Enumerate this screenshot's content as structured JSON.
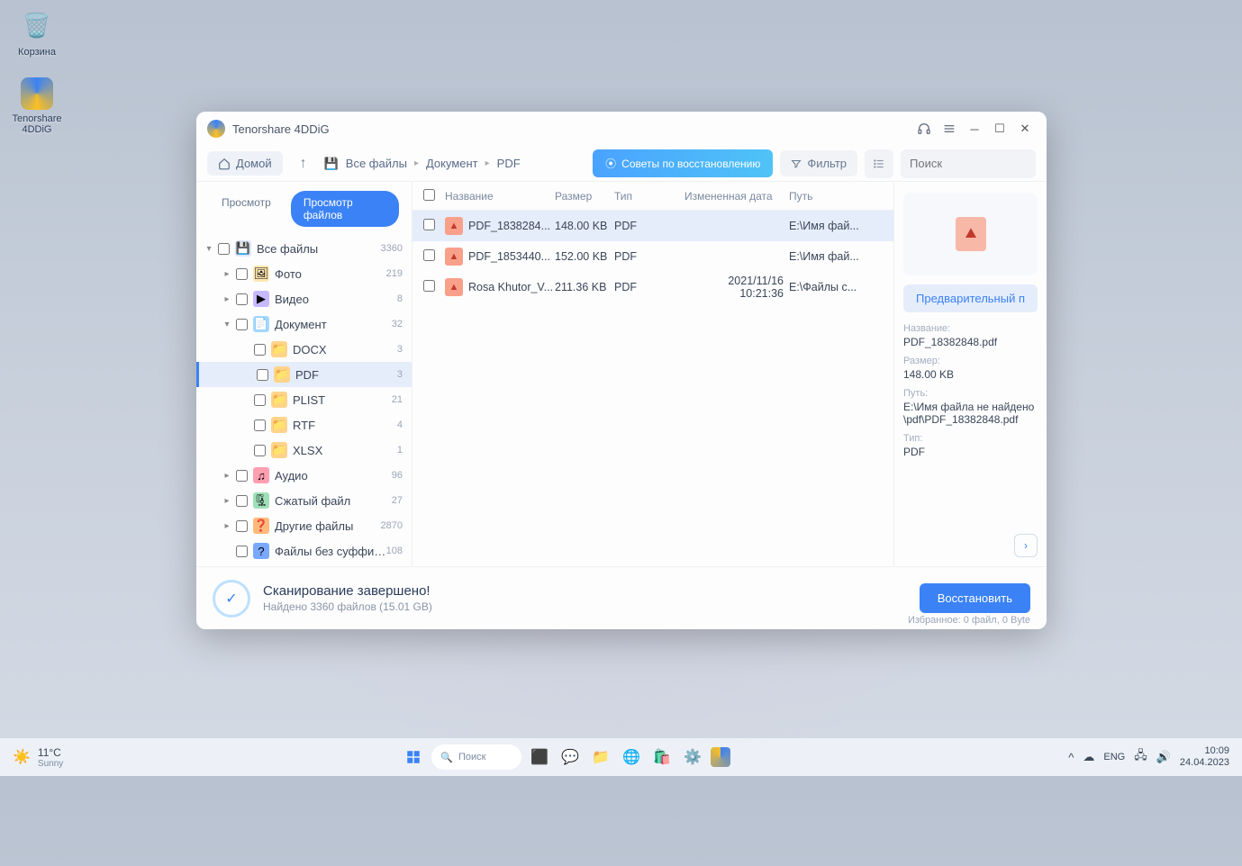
{
  "desktop": {
    "recycle_bin": "Корзина",
    "app_shortcut": "Tenorshare 4DDiG"
  },
  "window": {
    "title": "Tenorshare 4DDiG",
    "home": "Домой",
    "breadcrumb": [
      "Все файлы",
      "Документ",
      "PDF"
    ],
    "tips_button": "Советы по восстановлению",
    "filter": "Фильтр",
    "search_placeholder": "Поиск"
  },
  "tabs": {
    "view": "Просмотр",
    "files": "Просмотр файлов"
  },
  "tree": [
    {
      "indent": 0,
      "expand": "▾",
      "checkbox": true,
      "icon": "💾",
      "iconbg": "#dbe7ff",
      "label": "Все файлы",
      "count": "3360"
    },
    {
      "indent": 1,
      "expand": "▸",
      "checkbox": true,
      "icon": "🖼",
      "iconbg": "#ffe7b3",
      "label": "Фото",
      "count": "219"
    },
    {
      "indent": 1,
      "expand": "▸",
      "checkbox": true,
      "icon": "▶",
      "iconbg": "#c7b8ff",
      "label": "Видео",
      "count": "8"
    },
    {
      "indent": 1,
      "expand": "▾",
      "checkbox": true,
      "icon": "📄",
      "iconbg": "#a5d8ff",
      "label": "Документ",
      "count": "32"
    },
    {
      "indent": 2,
      "expand": "",
      "checkbox": true,
      "icon": "📁",
      "iconbg": "#ffd48a",
      "label": "DOCX",
      "count": "3"
    },
    {
      "indent": 2,
      "expand": "",
      "checkbox": true,
      "icon": "📁",
      "iconbg": "#ffd48a",
      "label": "PDF",
      "count": "3",
      "active": true
    },
    {
      "indent": 2,
      "expand": "",
      "checkbox": true,
      "icon": "📁",
      "iconbg": "#ffd48a",
      "label": "PLIST",
      "count": "21"
    },
    {
      "indent": 2,
      "expand": "",
      "checkbox": true,
      "icon": "📁",
      "iconbg": "#ffd48a",
      "label": "RTF",
      "count": "4"
    },
    {
      "indent": 2,
      "expand": "",
      "checkbox": true,
      "icon": "📁",
      "iconbg": "#ffd48a",
      "label": "XLSX",
      "count": "1"
    },
    {
      "indent": 1,
      "expand": "▸",
      "checkbox": true,
      "icon": "♫",
      "iconbg": "#ff9fb0",
      "label": "Аудио",
      "count": "96"
    },
    {
      "indent": 1,
      "expand": "▸",
      "checkbox": true,
      "icon": "🗜",
      "iconbg": "#9fe0b8",
      "label": "Сжатый файл",
      "count": "27"
    },
    {
      "indent": 1,
      "expand": "▸",
      "checkbox": true,
      "icon": "❓",
      "iconbg": "#ffb97a",
      "label": "Другие файлы",
      "count": "2870"
    },
    {
      "indent": 1,
      "expand": "",
      "checkbox": true,
      "icon": "?",
      "iconbg": "#7aa8ff",
      "label": "Файлы без суффикса",
      "count": "108"
    }
  ],
  "file_header": {
    "name": "Название",
    "size": "Размер",
    "type": "Тип",
    "date": "Измененная дата",
    "path": "Путь"
  },
  "files": [
    {
      "name": "PDF_1838284...",
      "size": "148.00 KB",
      "type": "PDF",
      "date": "",
      "path": "E:\\Имя фай...",
      "selected": true
    },
    {
      "name": "PDF_1853440...",
      "size": "152.00 KB",
      "type": "PDF",
      "date": "",
      "path": "E:\\Имя фай..."
    },
    {
      "name": "Rosa Khutor_V...",
      "size": "211.36 KB",
      "type": "PDF",
      "date": "2021/11/16 10:21:36",
      "path": "E:\\Файлы с..."
    }
  ],
  "preview": {
    "button": "Предварительный п",
    "name_label": "Название:",
    "name": "PDF_18382848.pdf",
    "size_label": "Размер:",
    "size": "148.00 KB",
    "path_label": "Путь:",
    "path": "E:\\Имя файла не найдено\\pdf\\PDF_18382848.pdf",
    "type_label": "Тип:",
    "type": "PDF"
  },
  "status": {
    "title": "Сканирование завершено!",
    "subtitle": "Найдено 3360 файлов (15.01 GB)",
    "recover": "Восстановить",
    "selected": "Избранное: 0 файл, 0 Byte"
  },
  "taskbar": {
    "weather_temp": "11°C",
    "weather_cond": "Sunny",
    "search": "Поиск",
    "lang": "ENG",
    "time": "10:09",
    "date": "24.04.2023"
  }
}
